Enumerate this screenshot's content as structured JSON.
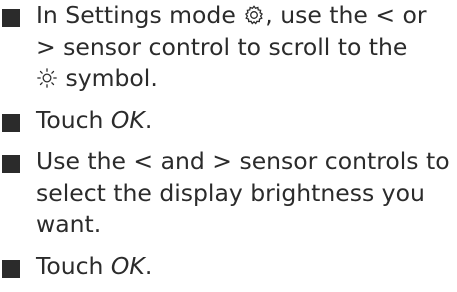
{
  "steps": [
    {
      "line1_a": "In Settings mode ",
      "settings_icon": "gear-icon",
      "line1_b": ", use the ",
      "lt_symbol": "<",
      "line1_c": " or",
      "gt_symbol": ">",
      "line2": " sensor control to scroll to the",
      "brightness_icon": "sun-icon",
      "line3": " symbol."
    },
    {
      "prefix": "Touch ",
      "emphasis": "OK",
      "suffix": "."
    },
    {
      "line1_a": "Use the ",
      "lt_symbol": "<",
      "line1_b": " and ",
      "gt_symbol": ">",
      "line1_c": " sensor controls to",
      "line2": "select the display brightness you",
      "line3": "want."
    },
    {
      "prefix": "Touch ",
      "emphasis": "OK",
      "suffix": "."
    }
  ],
  "colors": {
    "text": "#2b2b2b",
    "bullet": "#2b2b2b",
    "background": "#ffffff"
  }
}
